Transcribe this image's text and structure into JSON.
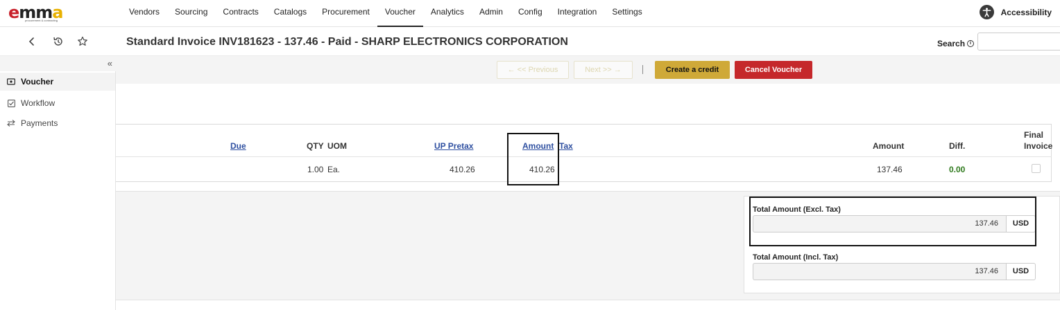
{
  "nav": {
    "logo_letters": [
      "e",
      "mm",
      "a"
    ],
    "logo_tagline": "procurement & contracting",
    "items": [
      "Vendors",
      "Sourcing",
      "Contracts",
      "Catalogs",
      "Procurement",
      "Voucher",
      "Analytics",
      "Admin",
      "Config",
      "Integration",
      "Settings"
    ],
    "active": "Voucher",
    "accessibility_label": "Accessibility"
  },
  "header": {
    "title": "Standard Invoice INV181623 - 137.46 - Paid - SHARP ELECTRONICS CORPORATION",
    "search_label": "Search",
    "search_value": "",
    "icons": [
      "back-icon",
      "history-icon",
      "star-icon"
    ]
  },
  "sidebar": {
    "collapse": "«",
    "items": [
      {
        "label": "Voucher",
        "icon": "voucher-icon",
        "active": true
      },
      {
        "label": "Workflow",
        "icon": "checkbox-icon",
        "active": false
      },
      {
        "label": "Payments",
        "icon": "transfer-icon",
        "active": false
      }
    ]
  },
  "toolbar": {
    "prev": "← << Previous",
    "next": "Next >> →",
    "sep": "|",
    "create_credit": "Create a credit",
    "cancel_voucher": "Cancel Voucher"
  },
  "table": {
    "headers": {
      "due": "Due",
      "qty": "QTY",
      "uom": "UOM",
      "up_pretax": "UP Pretax",
      "amount": "Amount",
      "tax": "Tax",
      "amount2": "Amount",
      "diff": "Diff.",
      "final_invoice_1": "Final",
      "final_invoice_2": "Invoice"
    },
    "rows": [
      {
        "qty": "1.00",
        "uom": "Ea.",
        "up_pretax": "410.26",
        "amount": "410.26",
        "amount2": "137.46",
        "diff": "0.00",
        "final_invoice": false
      }
    ]
  },
  "totals": {
    "excl_label": "Total Amount (Excl. Tax)",
    "excl_value": "137.46",
    "excl_currency": "USD",
    "incl_label": "Total Amount (Incl. Tax)",
    "incl_value": "137.46",
    "incl_currency": "USD"
  },
  "colors": {
    "brand_red": "#c8202a",
    "brand_gold": "#e8b100",
    "credit_button": "#cfa938",
    "cancel_button": "#c5282b",
    "link": "#2e4fa0",
    "diff_green": "#2f7a1d"
  }
}
